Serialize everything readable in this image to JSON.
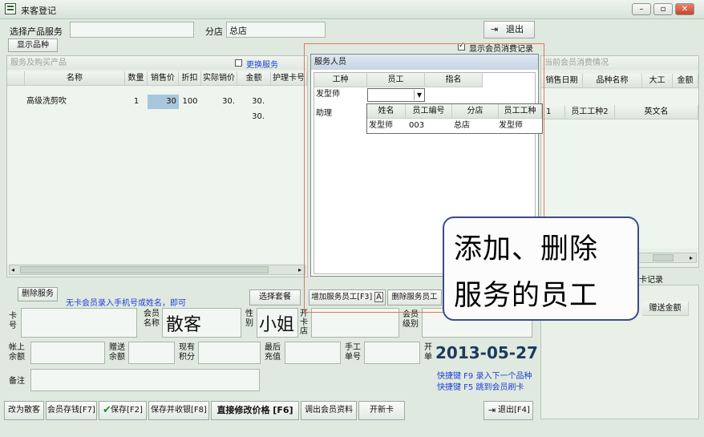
{
  "window": {
    "title": "来客登记"
  },
  "top": {
    "product_label": "选择产品服务",
    "branch_label": "分店",
    "branch_value": "总店",
    "exit_label": "退出",
    "show_products_label": "显示品种",
    "show_member_records_label": "显示会员消费记录"
  },
  "left_panel": {
    "title": "服务及购买产品",
    "change_service_label": "更换服务",
    "columns": [
      "名称",
      "数量",
      "销售价",
      "折扣",
      "实际销价",
      "金额",
      "护理卡号"
    ],
    "rows": [
      {
        "name": "高级洗剪吹",
        "qty": "1",
        "price": "30",
        "discount": "100",
        "actual": "30.",
        "amount": "30."
      }
    ],
    "total_amount": "30."
  },
  "staff_panel": {
    "title": "服务人员",
    "columns": [
      "工种",
      "员工",
      "指名"
    ],
    "rows": [
      "发型师",
      "助理"
    ],
    "dropdown_columns": [
      "姓名",
      "员工编号",
      "分店",
      "员工工种"
    ],
    "dropdown_row": {
      "name": "发型师",
      "id": "003",
      "branch": "总店",
      "type": "发型师"
    },
    "add_staff_label": "增加服务员工[F3]",
    "add_staff_key": "A",
    "delete_staff_label": "删除服务员工"
  },
  "right_panel": {
    "title": "当前会员消费情况",
    "columns": [
      "销售日期",
      "品种名称",
      "大工",
      "金额"
    ],
    "second_columns": [
      "1",
      "员工工种2",
      "英文名"
    ],
    "records_label": "卡记录",
    "gift_amount_label": "赠送金额"
  },
  "member": {
    "delete_service_label": "删除服务",
    "hint": "无卡会员录入手机号或姓名，即可",
    "select_package_label": "选择套餐",
    "card_label": "卡号",
    "member_name_label": "会员名称",
    "member_name_value": "散客",
    "gender_label": "性别",
    "gender_value": "小姐",
    "open_store_label": "开卡店",
    "member_level_label": "会员级别",
    "account_balance_label": "帐上余额",
    "gift_balance_label": "赠送余额",
    "points_label": "现有积分",
    "last_recharge_label": "最后充值",
    "manual_no_label": "手工单号",
    "open_label": "开单",
    "date_value": "2013-05-27",
    "note_label": "备注",
    "shortcut1": "快捷键 F9 录入下一个品种",
    "shortcut2": "快捷键 F5 跳到会员刷卡"
  },
  "bottom": {
    "to_walkin": "改为散客",
    "member_deposit": "会员存钱[F7]",
    "save": "保存[F2]",
    "save_checkout": "保存并收银[F8]",
    "edit_price": "直接修改价格",
    "edit_price_key": "[F6]",
    "load_member": "调出会员资料",
    "new_card": "开新卡",
    "exit": "退出[F4]"
  },
  "overlay": {
    "line1": "添加、删除",
    "line2": "服务的员工"
  }
}
